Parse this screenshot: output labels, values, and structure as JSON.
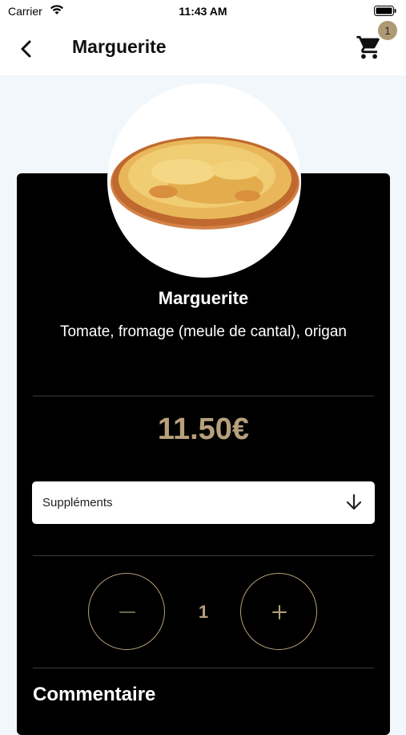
{
  "status_bar": {
    "carrier": "Carrier",
    "time": "11:43 AM"
  },
  "header": {
    "title": "Marguerite",
    "cart_count": "1"
  },
  "product": {
    "name": "Marguerite",
    "description": "Tomate, fromage (meule de cantal), origan",
    "price": "11.50€"
  },
  "supplements": {
    "label": "Suppléments"
  },
  "quantity": {
    "value": "1"
  },
  "comment": {
    "title": "Commentaire"
  },
  "colors": {
    "accent": "#b7a07b",
    "card_background": "#000000",
    "page_background": "#f1f7fa",
    "badge": "#b09a75"
  },
  "icons": [
    "wifi-icon",
    "battery-icon",
    "back-arrow-icon",
    "cart-icon",
    "arrow-down-icon",
    "minus-icon",
    "plus-icon"
  ]
}
